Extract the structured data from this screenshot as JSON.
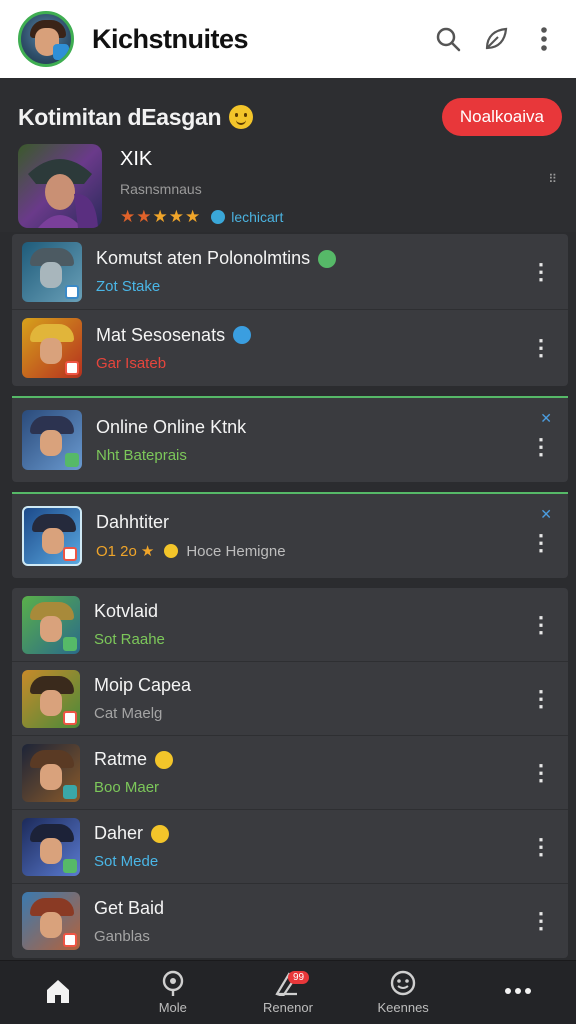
{
  "header": {
    "title": "Kichstnuites",
    "icons": [
      "search-icon",
      "leaf-icon",
      "more-vert-icon"
    ]
  },
  "featured": {
    "title": "Kotimitan dEasgan",
    "button": "Noalkoaiva",
    "name": "XIK",
    "subtitle": "Rasnsmnaus",
    "tag": "lechicart",
    "more": "⠿"
  },
  "list": {
    "groups": [
      {
        "items": [
          {
            "title": "Komutst aten Polonolmtins",
            "sub": "Zot Stake",
            "sub_color": "blue"
          },
          {
            "title": "Mat Sesosenats",
            "sub": "Gar Isateb",
            "sub_color": "red"
          }
        ]
      },
      {
        "items": [
          {
            "title": "Online Online Ktnk",
            "sub": "Nht Bateprais",
            "sub_color": "green"
          }
        ]
      },
      {
        "items": [
          {
            "title": "Dahhtiter",
            "rating": "O1 2o",
            "rating_label": "Hoce Hemigne"
          }
        ]
      },
      {
        "items": [
          {
            "title": "Kotvlaid",
            "sub": "Sot Raahe",
            "sub_color": "green"
          },
          {
            "title": "Moip Capea",
            "sub": "Cat Maelg",
            "sub_color": "gray"
          },
          {
            "title": "Ratme",
            "sub": "Boo Maer",
            "sub_color": "green"
          },
          {
            "title": "Daher",
            "sub": "Sot Mede",
            "sub_color": "blue"
          },
          {
            "title": "Get Baid",
            "sub": "Ganblas",
            "sub_color": "gray"
          }
        ]
      }
    ]
  },
  "bottom_nav": {
    "items": [
      {
        "label": "",
        "icon": "home-icon"
      },
      {
        "label": "Mole",
        "icon": "map-pin-icon"
      },
      {
        "label": "Renenor",
        "icon": "edit-icon",
        "badge": "99"
      },
      {
        "label": "Keennes",
        "icon": "smile-icon"
      },
      {
        "label": "",
        "icon": "more-horiz-icon"
      }
    ]
  },
  "colors": {
    "accent_red": "#e8373a",
    "accent_green": "#56b968",
    "accent_blue": "#4ab6e6",
    "background": "#2b2c2f"
  }
}
